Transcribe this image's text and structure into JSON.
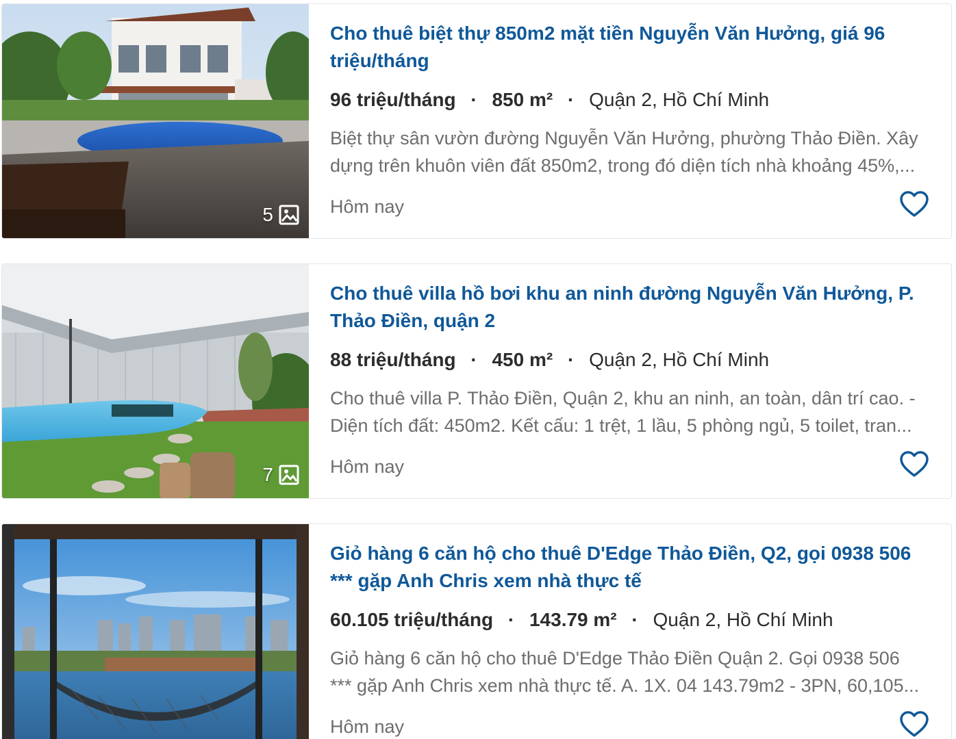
{
  "listings": [
    {
      "title": "Cho thuê biệt thự 850m2 mặt tiền Nguyễn Văn Hưởng, giá 96 triệu/tháng",
      "price": "96 triệu/tháng",
      "area": "850 m²",
      "separator": "·",
      "location": "Quận 2, Hồ Chí Minh",
      "desc_line1": "Biệt thự sân vườn đường Nguyễn Văn Hưởng, phường Thảo Điền. Xây",
      "desc_line2": "dựng trên khuôn viên đất 850m2, trong đó diện tích nhà khoảng 45%,...",
      "date": "Hôm nay",
      "photo_count": "5",
      "icon": "heart-outline-icon"
    },
    {
      "title": "Cho thuê villa hồ bơi khu an ninh đường Nguyễn Văn Hưởng, P. Thảo Điền, quận 2",
      "price": "88 triệu/tháng",
      "area": "450 m²",
      "separator": "·",
      "location": "Quận 2, Hồ Chí Minh",
      "desc_line1": "Cho thuê villa P. Thảo Điền, Quận 2, khu an ninh, an toàn, dân trí cao. -",
      "desc_line2": "Diện tích đất: 450m2. Kết cấu: 1 trệt, 1 lầu, 5 phòng ngủ, 5 toilet, tran...",
      "date": "Hôm nay",
      "photo_count": "7",
      "icon": "heart-outline-icon"
    },
    {
      "title": "Giỏ hàng 6 căn hộ cho thuê D'Edge Thảo Điền, Q2, gọi 0938 506 *** gặp Anh Chris xem nhà thực tế",
      "price": "60.105 triệu/tháng",
      "area": "143.79 m²",
      "separator": "·",
      "location": "Quận 2, Hồ Chí Minh",
      "desc_line1": "Giỏ hàng 6 căn hộ cho thuê D'Edge Thảo Điền Quận 2. Gọi 0938 506",
      "desc_line2": "*** gặp Anh Chris xem nhà thực tế. A. 1X. 04 143.79m2 - 3PN, 60,105...",
      "date": "Hôm nay",
      "icon": "heart-outline-icon"
    }
  ],
  "colors": {
    "title": "#0f5899",
    "heart": "#0f5899",
    "text": "#2c2c2c",
    "muted": "#6d6d6d"
  }
}
